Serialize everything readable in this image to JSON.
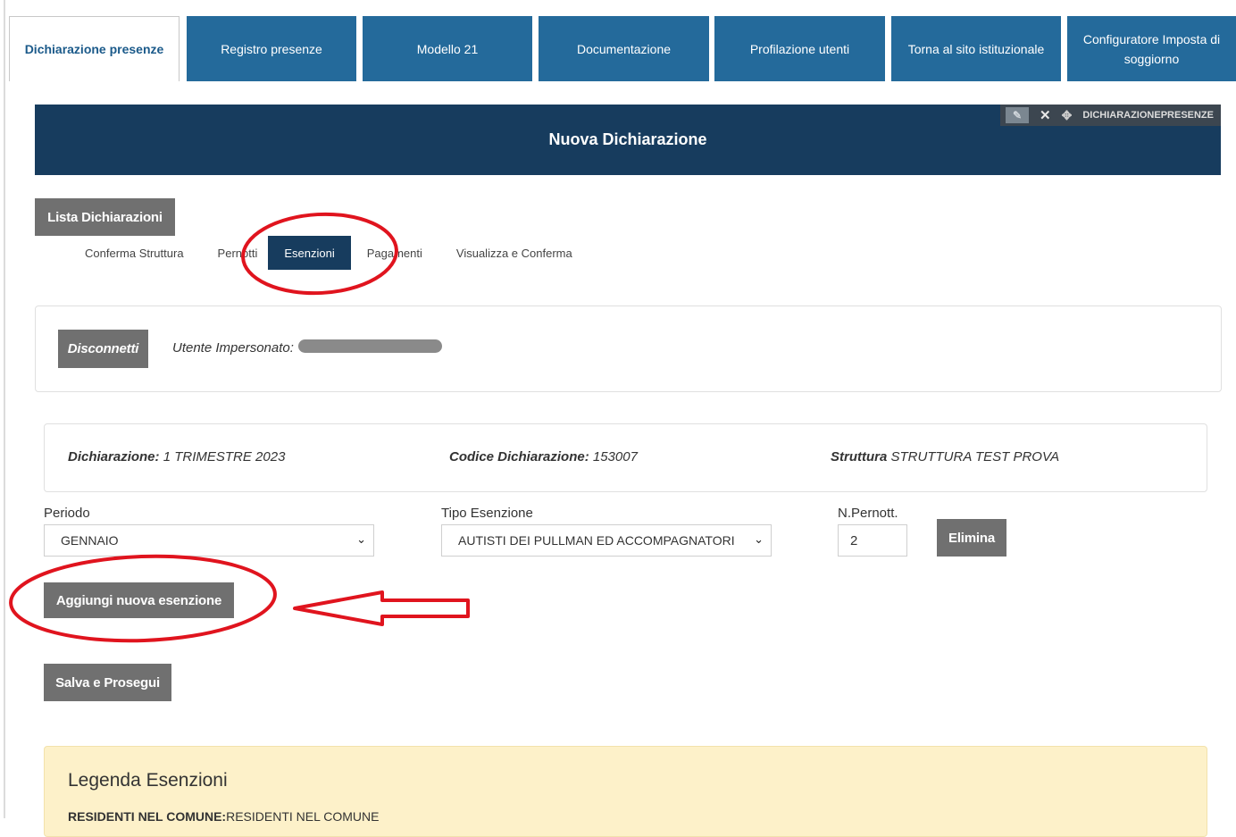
{
  "nav": {
    "tabs": [
      {
        "label": "Dichiarazione presenze"
      },
      {
        "label": "Registro presenze"
      },
      {
        "label": "Modello 21"
      },
      {
        "label": "Documentazione"
      },
      {
        "label": "Profilazione utenti"
      },
      {
        "label": "Torna al sito istituzionale"
      },
      {
        "label": "Configuratore Imposta di soggiorno"
      }
    ],
    "active_tab": "Dichiarazione presenze"
  },
  "banner": {
    "title": "Nuova Dichiarazione",
    "tool_label": "DICHIARAZIONEPRESENZE"
  },
  "buttons": {
    "list": "Lista Dichiarazioni",
    "disconnect": "Disconnetti",
    "delete": "Elimina",
    "add_exemption": "Aggiungi nuova esenzione",
    "save": "Salva e Prosegui"
  },
  "steps": [
    {
      "label": "Conferma Struttura"
    },
    {
      "label": "Pernotti"
    },
    {
      "label": "Esenzioni"
    },
    {
      "label": "Pagamenti"
    },
    {
      "label": "Visualizza e Conferma"
    }
  ],
  "active_step": "Esenzioni",
  "impersonation": {
    "label": "Utente Impersonato:"
  },
  "declaration": {
    "dichiarazione_label": "Dichiarazione:",
    "dichiarazione_value": "1 TRIMESTRE 2023",
    "codice_label": "Codice Dichiarazione:",
    "codice_value": "153007",
    "struttura_label": "Struttura",
    "struttura_value": "STRUTTURA TEST PROVA"
  },
  "form": {
    "periodo_label": "Periodo",
    "periodo_value": "GENNAIO",
    "tipo_label": "Tipo Esenzione",
    "tipo_value": "AUTISTI DEI PULLMAN ED ACCOMPAGNATORI",
    "pernott_label": "N.Pernott.",
    "pernott_value": "2"
  },
  "legend": {
    "title": "Legenda Esenzioni",
    "first_bold": "RESIDENTI NEL COMUNE:",
    "first_text": "RESIDENTI NEL COMUNE"
  },
  "colors": {
    "tab_blue": "#246a9b",
    "banner_navy": "#173c5e",
    "button_gray": "#707070",
    "legend_bg": "#fdf1c9",
    "annotation_red": "#e0141e"
  }
}
